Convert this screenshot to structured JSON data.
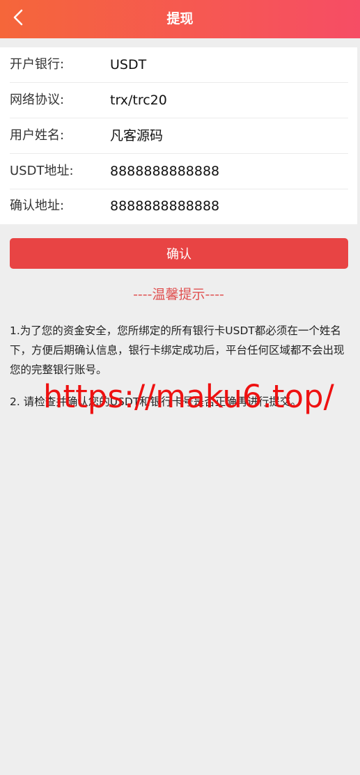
{
  "header": {
    "title": "提现",
    "back_icon": "chevron-left-icon",
    "gradient_start": "#f5663a",
    "gradient_end": "#f64d65"
  },
  "form": {
    "rows": [
      {
        "label": "开户银行:",
        "value": "USDT"
      },
      {
        "label": "网络协议:",
        "value": "trx/trc20"
      },
      {
        "label": "用户姓名:",
        "value": "凡客源码"
      },
      {
        "label": "USDT地址:",
        "value": "8888888888888"
      },
      {
        "label": "确认地址:",
        "value": "8888888888888"
      }
    ]
  },
  "confirm_button": {
    "label": "确认",
    "color": "#e84444"
  },
  "tips": {
    "title": "----温馨提示----",
    "items": [
      "1.为了您的资金安全，您所绑定的所有银行卡USDT都必须在一个姓名下，方便后期确认信息，银行卡绑定成功后，平台任何区域都不会出现您的完整银行账号。",
      "2. 请检查并确认您的USDT和银行卡号是否正确再进行提交。"
    ]
  },
  "watermark": {
    "text": "https://maku6.top/",
    "color": "#ee1111"
  }
}
